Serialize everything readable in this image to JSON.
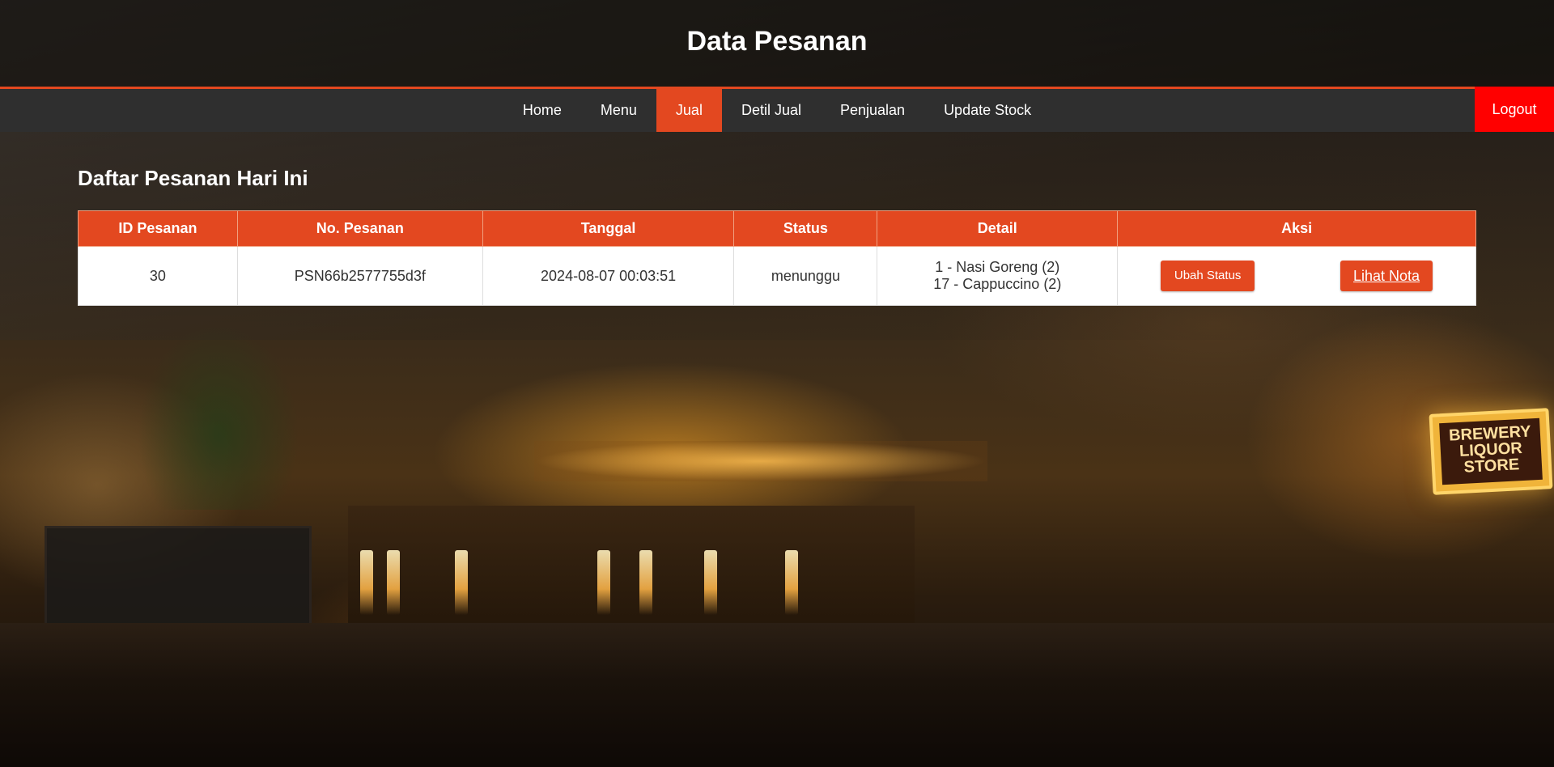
{
  "header": {
    "title": "Data Pesanan"
  },
  "nav": {
    "items": [
      {
        "label": "Home",
        "active": false
      },
      {
        "label": "Menu",
        "active": false
      },
      {
        "label": "Jual",
        "active": true
      },
      {
        "label": "Detil Jual",
        "active": false
      },
      {
        "label": "Penjualan",
        "active": false
      },
      {
        "label": "Update Stock",
        "active": false
      }
    ],
    "logout": "Logout"
  },
  "main": {
    "heading": "Daftar Pesanan Hari Ini",
    "table": {
      "columns": [
        "ID Pesanan",
        "No. Pesanan",
        "Tanggal",
        "Status",
        "Detail",
        "Aksi"
      ],
      "rows": [
        {
          "id": "30",
          "no": "PSN66b2577755d3f",
          "tanggal": "2024-08-07 00:03:51",
          "status": "menunggu",
          "detail": [
            "1 - Nasi Goreng (2)",
            "17 - Cappuccino (2)"
          ],
          "actions": {
            "ubah_status": "Ubah Status",
            "lihat_nota": "Lihat Nota"
          }
        }
      ]
    }
  },
  "background": {
    "sign_text": "BREWERY LIQUOR STORE"
  },
  "colors": {
    "accent": "#e34820",
    "nav_bg": "#2f2f2f",
    "logout_bg": "#ff0000"
  }
}
